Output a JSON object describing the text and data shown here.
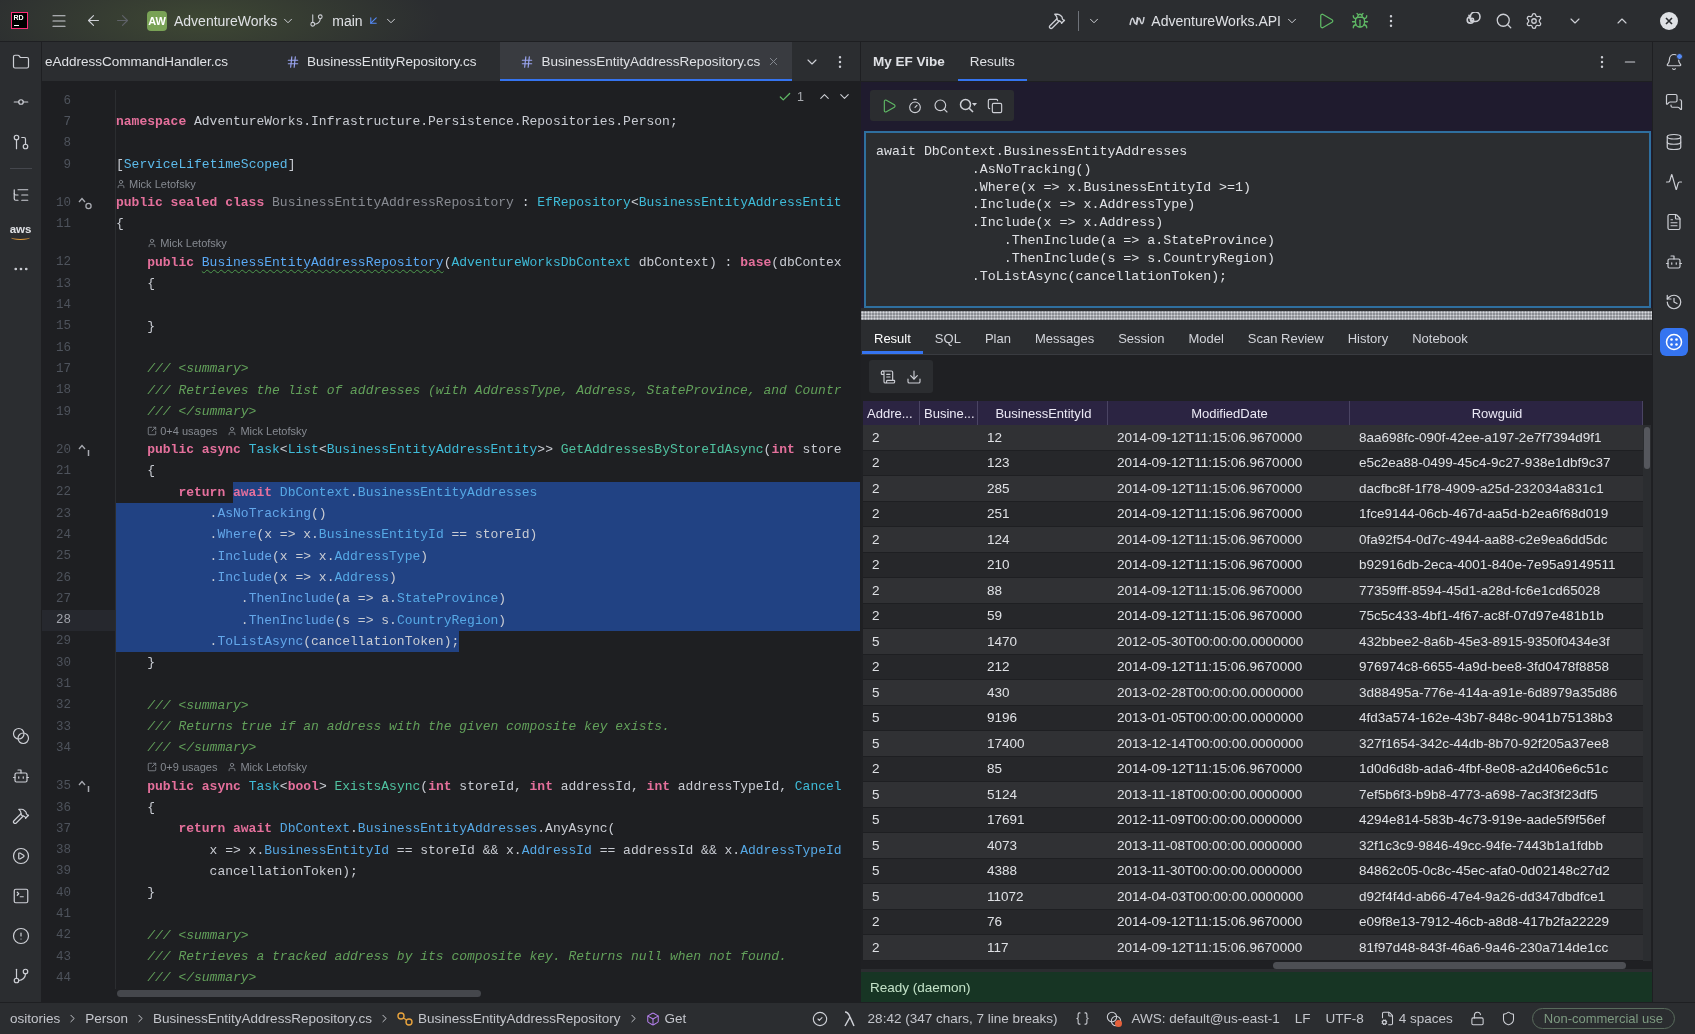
{
  "title_bar": {
    "logo": "RD",
    "nav": [
      {
        "kind": "back",
        "disabled": false
      },
      {
        "kind": "forward",
        "disabled": true
      }
    ],
    "project": {
      "badge": "AW",
      "name": "AdventureWorks"
    },
    "branch": {
      "name": "main",
      "incoming": true
    },
    "run_config": {
      "name": "AdventureWorks.API"
    }
  },
  "left_toolbar": {
    "top": [
      {
        "kind": "project",
        "selected": false
      },
      {
        "kind": "commit",
        "selected": false
      },
      {
        "kind": "pull-requests",
        "selected": false
      }
    ],
    "middle": [
      {
        "kind": "structure",
        "selected": false
      },
      {
        "kind": "aws",
        "label": "aws",
        "selected": false
      },
      {
        "kind": "more",
        "selected": false
      }
    ],
    "bottom": [
      {
        "kind": "services",
        "selected": false
      },
      {
        "kind": "copilot",
        "selected": false
      },
      {
        "kind": "build",
        "selected": false
      },
      {
        "kind": "run",
        "selected": false
      },
      {
        "kind": "terminal",
        "selected": false
      },
      {
        "kind": "problems",
        "selected": false
      },
      {
        "kind": "git",
        "selected": false
      }
    ]
  },
  "editor": {
    "tabs": [
      {
        "label": "eAddressCommandHandler.cs",
        "selected": false,
        "cut_off": true
      },
      {
        "label": "BusinessEntityRepository.cs",
        "selected": false,
        "cut_off": false
      },
      {
        "label": "BusinessEntityAddressRepository.cs",
        "selected": true,
        "cut_off": false
      }
    ],
    "inspection": {
      "count": "1"
    },
    "lines": [
      {
        "number": "6",
        "current": false
      },
      {
        "number": "7",
        "current": false,
        "segments": [
          {
            "selected": false,
            "tokens": [
              {
                "kind": "keyword",
                "text": "namespace"
              },
              {
                "kind": "plain",
                "text": " AdventureWorks.Infrastructure.Persistence.Repositories.Person;"
              }
            ]
          }
        ]
      },
      {
        "number": "8",
        "current": false
      },
      {
        "number": "9",
        "current": false,
        "segments": [
          {
            "selected": false,
            "tokens": [
              {
                "kind": "plain",
                "text": "["
              },
              {
                "kind": "attribute",
                "text": "ServiceLifetimeScoped"
              },
              {
                "kind": "plain",
                "text": "]"
              }
            ]
          }
        ]
      },
      {
        "number": "10",
        "current": false,
        "hint": {
          "author": "Mick Letofsky"
        },
        "gutter_mark": {
          "kind": "inherited"
        },
        "segments": [
          {
            "selected": false,
            "tokens": [
              {
                "kind": "keyword",
                "text": "public sealed class "
              },
              {
                "kind": "unused",
                "text": "BusinessEntityAddressRepository"
              },
              {
                "kind": "plain",
                "text": " : "
              },
              {
                "kind": "type",
                "text": "EfRepository"
              },
              {
                "kind": "plain",
                "text": "<"
              },
              {
                "kind": "type",
                "text": "BusinessEntityAddressEntit"
              }
            ]
          }
        ]
      },
      {
        "number": "11",
        "current": false,
        "segments": [
          {
            "selected": false,
            "tokens": [
              {
                "kind": "plain",
                "text": "{"
              }
            ]
          }
        ]
      },
      {
        "number": "12",
        "current": false,
        "hint": {
          "author": "Mick Letofsky"
        },
        "segments": [
          {
            "selected": false,
            "tokens": [
              {
                "kind": "keyword",
                "text": "    public "
              },
              {
                "kind": "constructor",
                "text": "BusinessEntityAddressRepository"
              },
              {
                "kind": "plain",
                "text": "("
              },
              {
                "kind": "type",
                "text": "AdventureWorksDbContext"
              },
              {
                "kind": "plain",
                "text": " dbContext) : "
              },
              {
                "kind": "keyword",
                "text": "base"
              },
              {
                "kind": "plain",
                "text": "(dbContex"
              }
            ]
          }
        ]
      },
      {
        "number": "13",
        "current": false,
        "segments": [
          {
            "selected": false,
            "tokens": [
              {
                "kind": "plain",
                "text": "    {"
              }
            ]
          }
        ]
      },
      {
        "number": "14",
        "current": false
      },
      {
        "number": "15",
        "current": false,
        "segments": [
          {
            "selected": false,
            "tokens": [
              {
                "kind": "plain",
                "text": "    }"
              }
            ]
          }
        ]
      },
      {
        "number": "16",
        "current": false
      },
      {
        "number": "17",
        "current": false,
        "segments": [
          {
            "selected": false,
            "tokens": [
              {
                "kind": "comment",
                "text": "    /// <summary>"
              }
            ]
          }
        ]
      },
      {
        "number": "18",
        "current": false,
        "segments": [
          {
            "selected": false,
            "tokens": [
              {
                "kind": "comment",
                "text": "    /// Retrieves the list of addresses (with AddressType, Address, StateProvince, and Countr"
              }
            ]
          }
        ]
      },
      {
        "number": "19",
        "current": false,
        "segments": [
          {
            "selected": false,
            "tokens": [
              {
                "kind": "comment",
                "text": "    /// </summary>"
              }
            ]
          }
        ]
      },
      {
        "number": "20",
        "current": false,
        "hint": {
          "usages": "0+4 usages",
          "author": "Mick Letofsky"
        },
        "gutter_mark": {
          "kind": "implemented"
        },
        "segments": [
          {
            "selected": false,
            "tokens": [
              {
                "kind": "keyword",
                "text": "    public async "
              },
              {
                "kind": "type",
                "text": "Task"
              },
              {
                "kind": "plain",
                "text": "<"
              },
              {
                "kind": "type",
                "text": "List"
              },
              {
                "kind": "plain",
                "text": "<"
              },
              {
                "kind": "type",
                "text": "BusinessEntityAddressEntity"
              },
              {
                "kind": "plain",
                "text": ">> "
              },
              {
                "kind": "method_decl",
                "text": "GetAddressesByStoreIdAsync"
              },
              {
                "kind": "plain",
                "text": "("
              },
              {
                "kind": "keyword",
                "text": "int"
              },
              {
                "kind": "plain",
                "text": " store"
              }
            ]
          }
        ]
      },
      {
        "number": "21",
        "current": false,
        "segments": [
          {
            "selected": false,
            "tokens": [
              {
                "kind": "plain",
                "text": "    {"
              }
            ]
          }
        ]
      },
      {
        "number": "22",
        "current": false,
        "segments": [
          {
            "selected": false,
            "tokens": [
              {
                "kind": "keyword",
                "text": "        return "
              }
            ]
          },
          {
            "selected": true,
            "tokens": [
              {
                "kind": "keyword",
                "text": "await "
              },
              {
                "kind": "property",
                "text": "DbContext"
              },
              {
                "kind": "plain",
                "text": "."
              },
              {
                "kind": "property",
                "text": "BusinessEntityAddresses"
              }
            ]
          }
        ]
      },
      {
        "number": "23",
        "current": false,
        "segments": [
          {
            "selected": true,
            "tokens": [
              {
                "kind": "plain",
                "text": "            ."
              },
              {
                "kind": "method",
                "text": "AsNoTracking"
              },
              {
                "kind": "plain",
                "text": "()"
              }
            ]
          }
        ]
      },
      {
        "number": "24",
        "current": false,
        "segments": [
          {
            "selected": true,
            "tokens": [
              {
                "kind": "plain",
                "text": "            ."
              },
              {
                "kind": "method",
                "text": "Where"
              },
              {
                "kind": "plain",
                "text": "(x => x."
              },
              {
                "kind": "property",
                "text": "BusinessEntityId"
              },
              {
                "kind": "plain",
                "text": " == storeId)"
              }
            ]
          }
        ]
      },
      {
        "number": "25",
        "current": false,
        "segments": [
          {
            "selected": true,
            "tokens": [
              {
                "kind": "plain",
                "text": "            ."
              },
              {
                "kind": "method",
                "text": "Include"
              },
              {
                "kind": "plain",
                "text": "(x => x."
              },
              {
                "kind": "property",
                "text": "AddressType"
              },
              {
                "kind": "plain",
                "text": ")"
              }
            ]
          }
        ]
      },
      {
        "number": "26",
        "current": false,
        "segments": [
          {
            "selected": true,
            "tokens": [
              {
                "kind": "plain",
                "text": "            ."
              },
              {
                "kind": "method",
                "text": "Include"
              },
              {
                "kind": "plain",
                "text": "(x => x."
              },
              {
                "kind": "property",
                "text": "Address"
              },
              {
                "kind": "plain",
                "text": ")"
              }
            ]
          }
        ]
      },
      {
        "number": "27",
        "current": false,
        "segments": [
          {
            "selected": true,
            "tokens": [
              {
                "kind": "plain",
                "text": "                ."
              },
              {
                "kind": "method",
                "text": "ThenInclude"
              },
              {
                "kind": "plain",
                "text": "(a => a."
              },
              {
                "kind": "property",
                "text": "StateProvince"
              },
              {
                "kind": "plain",
                "text": ")"
              }
            ]
          }
        ]
      },
      {
        "number": "28",
        "current": true,
        "segments": [
          {
            "selected": true,
            "tokens": [
              {
                "kind": "plain",
                "text": "                ."
              },
              {
                "kind": "method",
                "text": "ThenInclude"
              },
              {
                "kind": "plain",
                "text": "(s => s."
              },
              {
                "kind": "property",
                "text": "CountryRegion"
              },
              {
                "kind": "plain",
                "text": ")"
              }
            ]
          }
        ]
      },
      {
        "number": "29",
        "current": false,
        "segments": [
          {
            "selected": true,
            "tokens": [
              {
                "kind": "plain",
                "text": "            ."
              },
              {
                "kind": "method",
                "text": "ToListAsync"
              },
              {
                "kind": "plain",
                "text": "(cancellationToken);"
              }
            ]
          }
        ]
      },
      {
        "number": "30",
        "current": false,
        "segments": [
          {
            "selected": false,
            "tokens": [
              {
                "kind": "plain",
                "text": "    }"
              }
            ]
          }
        ]
      },
      {
        "number": "31",
        "current": false
      },
      {
        "number": "32",
        "current": false,
        "segments": [
          {
            "selected": false,
            "tokens": [
              {
                "kind": "comment",
                "text": "    /// <summary>"
              }
            ]
          }
        ]
      },
      {
        "number": "33",
        "current": false,
        "segments": [
          {
            "selected": false,
            "tokens": [
              {
                "kind": "comment",
                "text": "    /// Returns true if an address with the given composite key exists."
              }
            ]
          }
        ]
      },
      {
        "number": "34",
        "current": false,
        "segments": [
          {
            "selected": false,
            "tokens": [
              {
                "kind": "comment",
                "text": "    /// </summary>"
              }
            ]
          }
        ]
      },
      {
        "number": "35",
        "current": false,
        "hint": {
          "usages": "0+9 usages",
          "author": "Mick Letofsky"
        },
        "gutter_mark": {
          "kind": "implemented"
        },
        "segments": [
          {
            "selected": false,
            "tokens": [
              {
                "kind": "keyword",
                "text": "    public async "
              },
              {
                "kind": "type",
                "text": "Task"
              },
              {
                "kind": "plain",
                "text": "<"
              },
              {
                "kind": "keyword",
                "text": "bool"
              },
              {
                "kind": "plain",
                "text": "> "
              },
              {
                "kind": "method_decl",
                "text": "ExistsAsync"
              },
              {
                "kind": "plain",
                "text": "("
              },
              {
                "kind": "keyword",
                "text": "int"
              },
              {
                "kind": "plain",
                "text": " storeId, "
              },
              {
                "kind": "keyword",
                "text": "int"
              },
              {
                "kind": "plain",
                "text": " addressId, "
              },
              {
                "kind": "keyword",
                "text": "int"
              },
              {
                "kind": "plain",
                "text": " addressTypeId, "
              },
              {
                "kind": "type",
                "text": "Cancel"
              }
            ]
          }
        ]
      },
      {
        "number": "36",
        "current": false,
        "segments": [
          {
            "selected": false,
            "tokens": [
              {
                "kind": "plain",
                "text": "    {"
              }
            ]
          }
        ]
      },
      {
        "number": "37",
        "current": false,
        "segments": [
          {
            "selected": false,
            "tokens": [
              {
                "kind": "keyword",
                "text": "        return await "
              },
              {
                "kind": "property",
                "text": "DbContext"
              },
              {
                "kind": "plain",
                "text": "."
              },
              {
                "kind": "property",
                "text": "BusinessEntityAddresses"
              },
              {
                "kind": "plain",
                "text": ".AnyAsync("
              }
            ]
          }
        ]
      },
      {
        "number": "38",
        "current": false,
        "segments": [
          {
            "selected": false,
            "tokens": [
              {
                "kind": "plain",
                "text": "            x => x."
              },
              {
                "kind": "property",
                "text": "BusinessEntityId"
              },
              {
                "kind": "plain",
                "text": " == storeId && x."
              },
              {
                "kind": "property",
                "text": "AddressId"
              },
              {
                "kind": "plain",
                "text": " == addressId && x."
              },
              {
                "kind": "property",
                "text": "AddressTypeId"
              }
            ]
          }
        ]
      },
      {
        "number": "39",
        "current": false,
        "segments": [
          {
            "selected": false,
            "tokens": [
              {
                "kind": "plain",
                "text": "            cancellationToken);"
              }
            ]
          }
        ]
      },
      {
        "number": "40",
        "current": false,
        "segments": [
          {
            "selected": false,
            "tokens": [
              {
                "kind": "plain",
                "text": "    }"
              }
            ]
          }
        ]
      },
      {
        "number": "41",
        "current": false
      },
      {
        "number": "42",
        "current": false,
        "segments": [
          {
            "selected": false,
            "tokens": [
              {
                "kind": "comment",
                "text": "    /// <summary>"
              }
            ]
          }
        ]
      },
      {
        "number": "43",
        "current": false,
        "segments": [
          {
            "selected": false,
            "tokens": [
              {
                "kind": "comment",
                "text": "    /// Retrieves a tracked address by its composite key. Returns null when not found."
              }
            ]
          }
        ]
      },
      {
        "number": "44",
        "current": false,
        "segments": [
          {
            "selected": false,
            "tokens": [
              {
                "kind": "comment",
                "text": "    /// </summary>"
              }
            ]
          }
        ]
      }
    ]
  },
  "ef_vibe": {
    "title": "My EF Vibe",
    "tabs": [
      {
        "label": "Results",
        "selected": true
      }
    ],
    "query": "await DbContext.BusinessEntityAddresses\n            .AsNoTracking()\n            .Where(x => x.BusinessEntityId >=1)\n            .Include(x => x.AddressType)\n            .Include(x => x.Address)\n                .ThenInclude(a => a.StateProvince)\n                .ThenInclude(s => s.CountryRegion)\n            .ToListAsync(cancellationToken);",
    "result_tabs": [
      {
        "label": "Result",
        "selected": true
      },
      {
        "label": "SQL",
        "selected": false
      },
      {
        "label": "Plan",
        "selected": false
      },
      {
        "label": "Messages",
        "selected": false
      },
      {
        "label": "Session",
        "selected": false
      },
      {
        "label": "Model",
        "selected": false
      },
      {
        "label": "Scan Review",
        "selected": false
      },
      {
        "label": "History",
        "selected": false
      },
      {
        "label": "Notebook",
        "selected": false
      }
    ],
    "table": {
      "columns": [
        "Addre...",
        "Busine...",
        "BusinessEntityId",
        "ModifiedDate",
        "Rowguid"
      ],
      "rows": [
        {
          "column_1": "2",
          "business_entity_id": "12",
          "modified_date": "2014-09-12T11:15:06.9670000",
          "rowguid": "8aa698fc-090f-42ee-a197-2e7f7394d9f1"
        },
        {
          "column_1": "2",
          "business_entity_id": "123",
          "modified_date": "2014-09-12T11:15:06.9670000",
          "rowguid": "e5c2ea88-0499-45c4-9c27-938e1dbf9c37"
        },
        {
          "column_1": "2",
          "business_entity_id": "285",
          "modified_date": "2014-09-12T11:15:06.9670000",
          "rowguid": "dacfbc8f-1f78-4909-a25d-232034a831c1"
        },
        {
          "column_1": "2",
          "business_entity_id": "251",
          "modified_date": "2014-09-12T11:15:06.9670000",
          "rowguid": "1fce9144-06cb-467d-aa5d-b2ea6f68d019"
        },
        {
          "column_1": "2",
          "business_entity_id": "124",
          "modified_date": "2014-09-12T11:15:06.9670000",
          "rowguid": "0fa92f54-0d7c-4944-aa88-c2e9ea6dd5dc"
        },
        {
          "column_1": "2",
          "business_entity_id": "210",
          "modified_date": "2014-09-12T11:15:06.9670000",
          "rowguid": "b92916db-2eca-4001-840e-7e95a9149511"
        },
        {
          "column_1": "2",
          "business_entity_id": "88",
          "modified_date": "2014-09-12T11:15:06.9670000",
          "rowguid": "77359fff-8594-45d1-a28d-fc6e1cd65028"
        },
        {
          "column_1": "2",
          "business_entity_id": "59",
          "modified_date": "2014-09-12T11:15:06.9670000",
          "rowguid": "75c5c433-4bf1-4f67-ac8f-07d97e481b1b"
        },
        {
          "column_1": "5",
          "business_entity_id": "1470",
          "modified_date": "2012-05-30T00:00:00.0000000",
          "rowguid": "432bbee2-8a6b-45e3-8915-9350f0434e3f"
        },
        {
          "column_1": "2",
          "business_entity_id": "212",
          "modified_date": "2014-09-12T11:15:06.9670000",
          "rowguid": "976974c8-6655-4a9d-bee8-3fd0478f8858"
        },
        {
          "column_1": "5",
          "business_entity_id": "430",
          "modified_date": "2013-02-28T00:00:00.0000000",
          "rowguid": "3d88495a-776e-414a-a91e-6d8979a35d86"
        },
        {
          "column_1": "5",
          "business_entity_id": "9196",
          "modified_date": "2013-01-05T00:00:00.0000000",
          "rowguid": "4fd3a574-162e-43b7-848c-9041b75138b3"
        },
        {
          "column_1": "5",
          "business_entity_id": "17400",
          "modified_date": "2013-12-14T00:00:00.0000000",
          "rowguid": "327f1654-342c-44db-8b70-92f205a37ee8"
        },
        {
          "column_1": "2",
          "business_entity_id": "85",
          "modified_date": "2014-09-12T11:15:06.9670000",
          "rowguid": "1d0d6d8b-ada6-4fbf-8e08-a2d406e6c51c"
        },
        {
          "column_1": "5",
          "business_entity_id": "5124",
          "modified_date": "2013-11-18T00:00:00.0000000",
          "rowguid": "7ef5b6f3-b9b8-4773-a698-7ac3f3f23df5"
        },
        {
          "column_1": "5",
          "business_entity_id": "17691",
          "modified_date": "2012-11-09T00:00:00.0000000",
          "rowguid": "4294e814-583b-4c73-919e-aade5f9f56ef"
        },
        {
          "column_1": "5",
          "business_entity_id": "4073",
          "modified_date": "2013-11-08T00:00:00.0000000",
          "rowguid": "32f1c3c9-9846-49cc-94fe-7443b1a1fdbb"
        },
        {
          "column_1": "5",
          "business_entity_id": "4388",
          "modified_date": "2013-11-30T00:00:00.0000000",
          "rowguid": "84862c05-0c8c-45ec-afa0-0d02148c27d2"
        },
        {
          "column_1": "5",
          "business_entity_id": "11072",
          "modified_date": "2014-04-03T00:00:00.0000000",
          "rowguid": "d92f4f4d-ab66-47e4-9a26-dd347dbdfce1"
        },
        {
          "column_1": "2",
          "business_entity_id": "76",
          "modified_date": "2014-09-12T11:15:06.9670000",
          "rowguid": "e09f8e13-7912-46cb-a8d8-417b2fa22229"
        },
        {
          "column_1": "2",
          "business_entity_id": "117",
          "modified_date": "2014-09-12T11:15:06.9670000",
          "rowguid": "81f97d48-843f-46a6-9a46-230a714de1cc"
        }
      ]
    },
    "status": "Ready (daemon)"
  },
  "right_toolbar": {
    "items": [
      {
        "kind": "notifications",
        "selected": false,
        "unread": true
      },
      {
        "kind": "assistant",
        "selected": false
      },
      {
        "kind": "database",
        "selected": false
      },
      {
        "kind": "profiler",
        "selected": false
      },
      {
        "kind": "log",
        "selected": false
      },
      {
        "kind": "copilot",
        "selected": false
      },
      {
        "kind": "history",
        "selected": false
      },
      {
        "kind": "ef-vibe",
        "selected": true
      }
    ]
  },
  "status_bar": {
    "breadcrumbs": [
      {
        "kind": "folder",
        "text": "ositories"
      },
      {
        "kind": "folder",
        "text": "Person"
      },
      {
        "kind": "file",
        "text": "BusinessEntityAddressRepository.cs"
      },
      {
        "kind": "class",
        "text": "BusinessEntityAddressRepository"
      },
      {
        "kind": "method",
        "text": "Get"
      }
    ],
    "position": "28:42 (347 chars, 7 line breaks)",
    "aws_profile": "AWS: default@us-east-1",
    "line_ending": "LF",
    "encoding": "UTF-8",
    "indent": "4 spaces",
    "license": "Non-commercial use"
  }
}
